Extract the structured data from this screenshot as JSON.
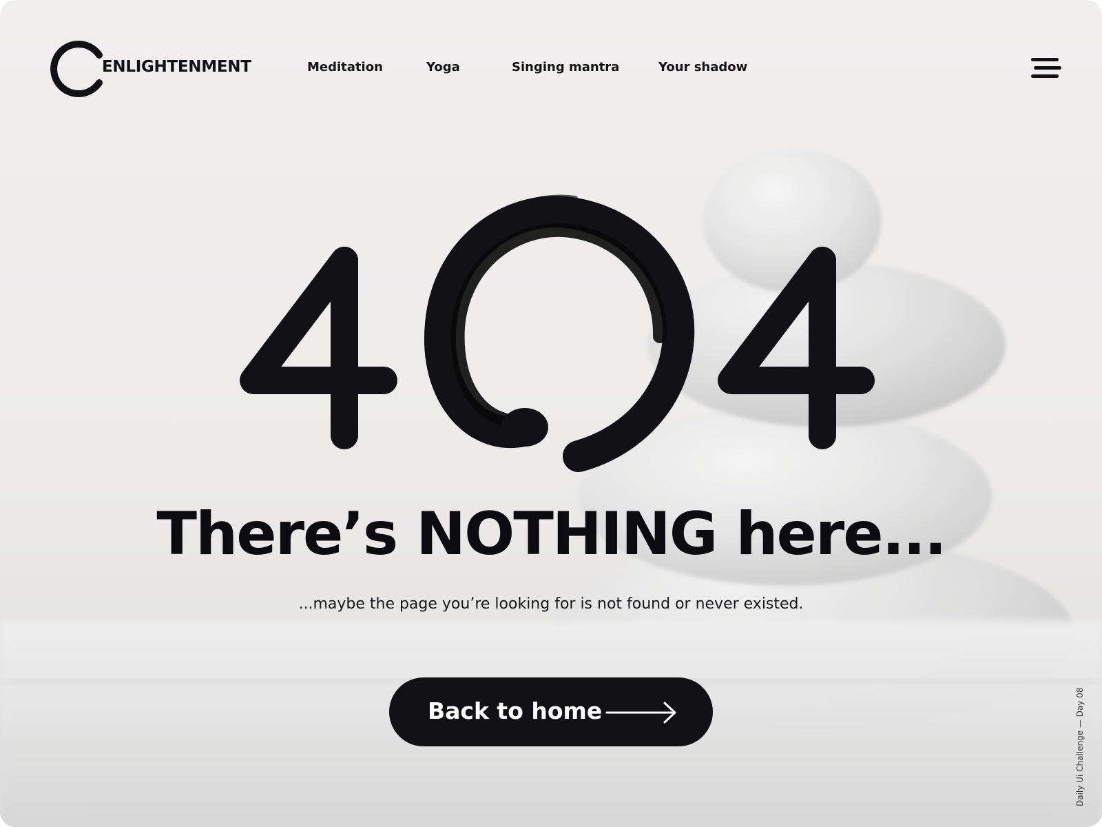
{
  "brand": {
    "name": "ENLIGHTENMENT",
    "logo_letter": "C"
  },
  "nav": {
    "items": [
      {
        "label": "Meditation"
      },
      {
        "label": "Yoga"
      },
      {
        "label": "Singing mantra"
      },
      {
        "label": "Your shadow"
      }
    ]
  },
  "menu_icon": "hamburger-menu-icon",
  "error": {
    "digit_left": "4",
    "digit_right": "4",
    "middle_icon": "enso-circle-icon"
  },
  "heading": "There’s NOTHING here...",
  "subtext": "...maybe the page you’re looking for is not found or never existed.",
  "cta": {
    "label": "Back to home",
    "icon": "arrow-right-icon"
  },
  "credit": "Daily Ui Challenge — Day 08",
  "colors": {
    "ink": "#121216",
    "background": "#efedec",
    "button_text": "#ffffff"
  }
}
